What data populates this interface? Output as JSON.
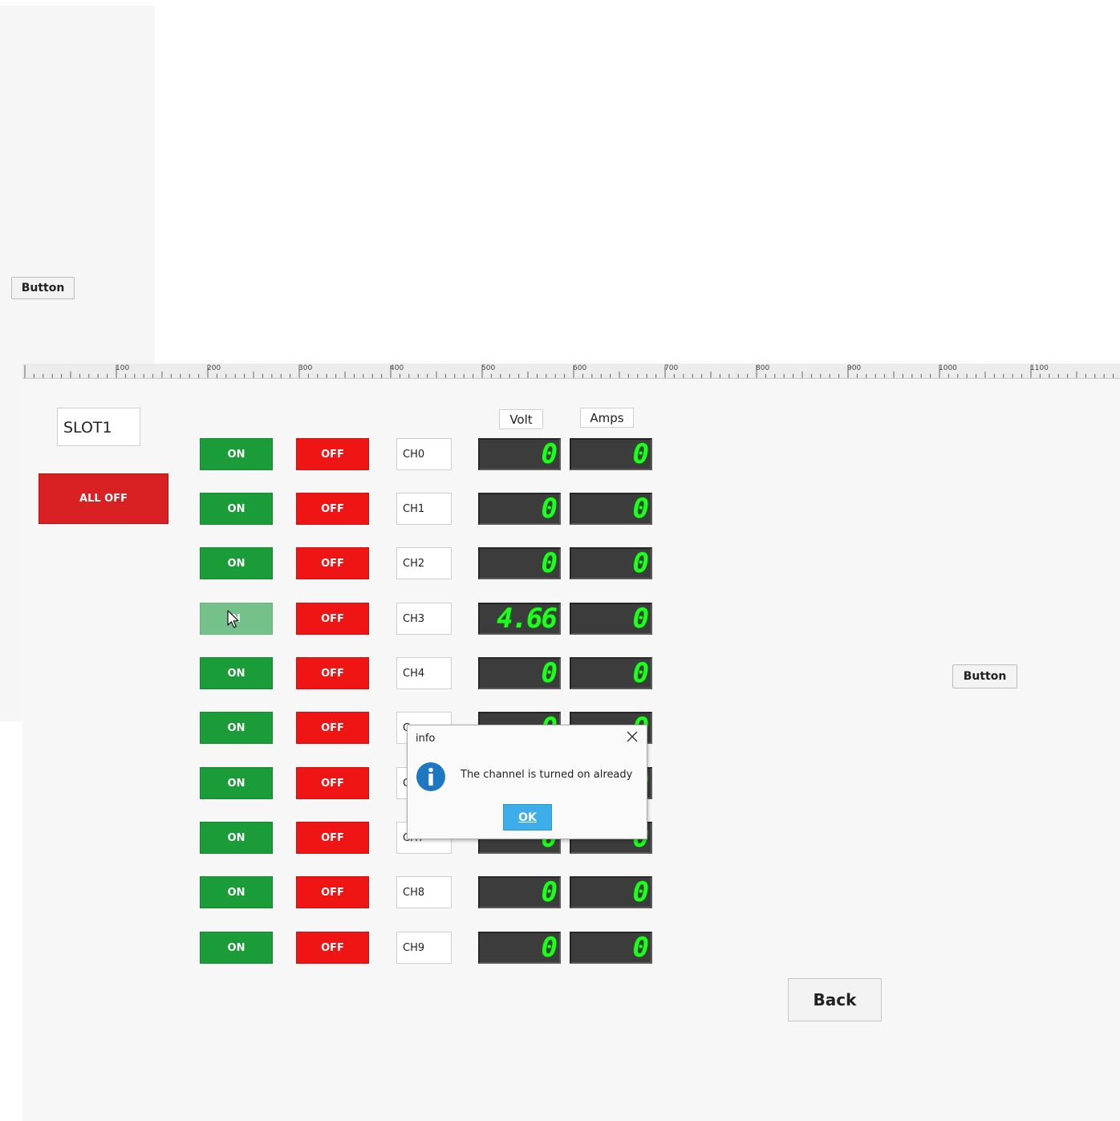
{
  "top_button_label": "Button",
  "side_button_label": "Button",
  "ruler_labels": [
    "100",
    "200",
    "300",
    "400",
    "500",
    "600",
    "700",
    "800",
    "900",
    "1000",
    "1100"
  ],
  "slot_label": "SLOT1",
  "all_off_label": "ALL OFF",
  "headers": {
    "volt": "Volt",
    "amps": "Amps"
  },
  "channels": [
    {
      "on": "ON",
      "off": "OFF",
      "name": "CH0",
      "volt": "0",
      "amps": "0"
    },
    {
      "on": "ON",
      "off": "OFF",
      "name": "CH1",
      "volt": "0",
      "amps": "0"
    },
    {
      "on": "ON",
      "off": "OFF",
      "name": "CH2",
      "volt": "0",
      "amps": "0"
    },
    {
      "on": "N",
      "off": "OFF",
      "name": "CH3",
      "volt": "4.66",
      "amps": "0"
    },
    {
      "on": "ON",
      "off": "OFF",
      "name": "CH4",
      "volt": "0",
      "amps": "0"
    },
    {
      "on": "ON",
      "off": "OFF",
      "name": "C",
      "volt": "0",
      "amps": "0"
    },
    {
      "on": "ON",
      "off": "OFF",
      "name": "C",
      "volt": "0",
      "amps": "0"
    },
    {
      "on": "ON",
      "off": "OFF",
      "name": "CH7",
      "volt": "0",
      "amps": "0"
    },
    {
      "on": "ON",
      "off": "OFF",
      "name": "CH8",
      "volt": "0",
      "amps": "0"
    },
    {
      "on": "ON",
      "off": "OFF",
      "name": "CH9",
      "volt": "0",
      "amps": "0"
    }
  ],
  "back_label": "Back",
  "dialog": {
    "title": "info",
    "message": "The channel is turned on already",
    "ok_label": "OK",
    "icon": "info-icon"
  },
  "colors": {
    "on_button": "#1a9c39",
    "off_button": "#f01515",
    "all_off": "#d92023",
    "lcd_digits": "#1dff1d",
    "ok_button": "#3daee9"
  }
}
